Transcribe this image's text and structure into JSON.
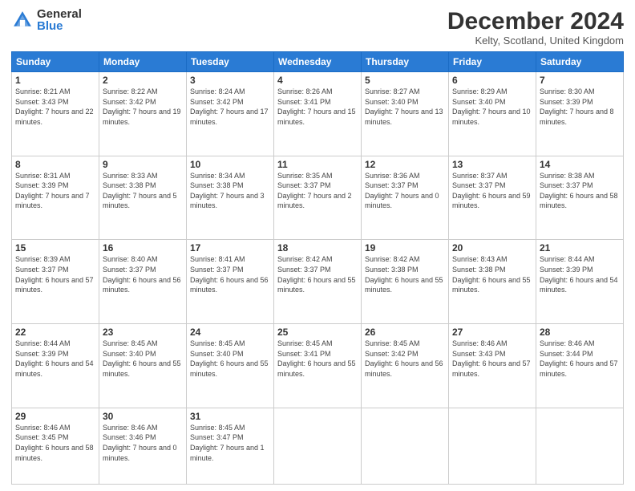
{
  "logo": {
    "general": "General",
    "blue": "Blue"
  },
  "title": "December 2024",
  "location": "Kelty, Scotland, United Kingdom",
  "days_of_week": [
    "Sunday",
    "Monday",
    "Tuesday",
    "Wednesday",
    "Thursday",
    "Friday",
    "Saturday"
  ],
  "weeks": [
    [
      {
        "day": "1",
        "sunrise": "Sunrise: 8:21 AM",
        "sunset": "Sunset: 3:43 PM",
        "daylight": "Daylight: 7 hours and 22 minutes."
      },
      {
        "day": "2",
        "sunrise": "Sunrise: 8:22 AM",
        "sunset": "Sunset: 3:42 PM",
        "daylight": "Daylight: 7 hours and 19 minutes."
      },
      {
        "day": "3",
        "sunrise": "Sunrise: 8:24 AM",
        "sunset": "Sunset: 3:42 PM",
        "daylight": "Daylight: 7 hours and 17 minutes."
      },
      {
        "day": "4",
        "sunrise": "Sunrise: 8:26 AM",
        "sunset": "Sunset: 3:41 PM",
        "daylight": "Daylight: 7 hours and 15 minutes."
      },
      {
        "day": "5",
        "sunrise": "Sunrise: 8:27 AM",
        "sunset": "Sunset: 3:40 PM",
        "daylight": "Daylight: 7 hours and 13 minutes."
      },
      {
        "day": "6",
        "sunrise": "Sunrise: 8:29 AM",
        "sunset": "Sunset: 3:40 PM",
        "daylight": "Daylight: 7 hours and 10 minutes."
      },
      {
        "day": "7",
        "sunrise": "Sunrise: 8:30 AM",
        "sunset": "Sunset: 3:39 PM",
        "daylight": "Daylight: 7 hours and 8 minutes."
      }
    ],
    [
      {
        "day": "8",
        "sunrise": "Sunrise: 8:31 AM",
        "sunset": "Sunset: 3:39 PM",
        "daylight": "Daylight: 7 hours and 7 minutes."
      },
      {
        "day": "9",
        "sunrise": "Sunrise: 8:33 AM",
        "sunset": "Sunset: 3:38 PM",
        "daylight": "Daylight: 7 hours and 5 minutes."
      },
      {
        "day": "10",
        "sunrise": "Sunrise: 8:34 AM",
        "sunset": "Sunset: 3:38 PM",
        "daylight": "Daylight: 7 hours and 3 minutes."
      },
      {
        "day": "11",
        "sunrise": "Sunrise: 8:35 AM",
        "sunset": "Sunset: 3:37 PM",
        "daylight": "Daylight: 7 hours and 2 minutes."
      },
      {
        "day": "12",
        "sunrise": "Sunrise: 8:36 AM",
        "sunset": "Sunset: 3:37 PM",
        "daylight": "Daylight: 7 hours and 0 minutes."
      },
      {
        "day": "13",
        "sunrise": "Sunrise: 8:37 AM",
        "sunset": "Sunset: 3:37 PM",
        "daylight": "Daylight: 6 hours and 59 minutes."
      },
      {
        "day": "14",
        "sunrise": "Sunrise: 8:38 AM",
        "sunset": "Sunset: 3:37 PM",
        "daylight": "Daylight: 6 hours and 58 minutes."
      }
    ],
    [
      {
        "day": "15",
        "sunrise": "Sunrise: 8:39 AM",
        "sunset": "Sunset: 3:37 PM",
        "daylight": "Daylight: 6 hours and 57 minutes."
      },
      {
        "day": "16",
        "sunrise": "Sunrise: 8:40 AM",
        "sunset": "Sunset: 3:37 PM",
        "daylight": "Daylight: 6 hours and 56 minutes."
      },
      {
        "day": "17",
        "sunrise": "Sunrise: 8:41 AM",
        "sunset": "Sunset: 3:37 PM",
        "daylight": "Daylight: 6 hours and 56 minutes."
      },
      {
        "day": "18",
        "sunrise": "Sunrise: 8:42 AM",
        "sunset": "Sunset: 3:37 PM",
        "daylight": "Daylight: 6 hours and 55 minutes."
      },
      {
        "day": "19",
        "sunrise": "Sunrise: 8:42 AM",
        "sunset": "Sunset: 3:38 PM",
        "daylight": "Daylight: 6 hours and 55 minutes."
      },
      {
        "day": "20",
        "sunrise": "Sunrise: 8:43 AM",
        "sunset": "Sunset: 3:38 PM",
        "daylight": "Daylight: 6 hours and 55 minutes."
      },
      {
        "day": "21",
        "sunrise": "Sunrise: 8:44 AM",
        "sunset": "Sunset: 3:39 PM",
        "daylight": "Daylight: 6 hours and 54 minutes."
      }
    ],
    [
      {
        "day": "22",
        "sunrise": "Sunrise: 8:44 AM",
        "sunset": "Sunset: 3:39 PM",
        "daylight": "Daylight: 6 hours and 54 minutes."
      },
      {
        "day": "23",
        "sunrise": "Sunrise: 8:45 AM",
        "sunset": "Sunset: 3:40 PM",
        "daylight": "Daylight: 6 hours and 55 minutes."
      },
      {
        "day": "24",
        "sunrise": "Sunrise: 8:45 AM",
        "sunset": "Sunset: 3:40 PM",
        "daylight": "Daylight: 6 hours and 55 minutes."
      },
      {
        "day": "25",
        "sunrise": "Sunrise: 8:45 AM",
        "sunset": "Sunset: 3:41 PM",
        "daylight": "Daylight: 6 hours and 55 minutes."
      },
      {
        "day": "26",
        "sunrise": "Sunrise: 8:45 AM",
        "sunset": "Sunset: 3:42 PM",
        "daylight": "Daylight: 6 hours and 56 minutes."
      },
      {
        "day": "27",
        "sunrise": "Sunrise: 8:46 AM",
        "sunset": "Sunset: 3:43 PM",
        "daylight": "Daylight: 6 hours and 57 minutes."
      },
      {
        "day": "28",
        "sunrise": "Sunrise: 8:46 AM",
        "sunset": "Sunset: 3:44 PM",
        "daylight": "Daylight: 6 hours and 57 minutes."
      }
    ],
    [
      {
        "day": "29",
        "sunrise": "Sunrise: 8:46 AM",
        "sunset": "Sunset: 3:45 PM",
        "daylight": "Daylight: 6 hours and 58 minutes."
      },
      {
        "day": "30",
        "sunrise": "Sunrise: 8:46 AM",
        "sunset": "Sunset: 3:46 PM",
        "daylight": "Daylight: 7 hours and 0 minutes."
      },
      {
        "day": "31",
        "sunrise": "Sunrise: 8:45 AM",
        "sunset": "Sunset: 3:47 PM",
        "daylight": "Daylight: 7 hours and 1 minute."
      },
      {
        "day": "",
        "sunrise": "",
        "sunset": "",
        "daylight": ""
      },
      {
        "day": "",
        "sunrise": "",
        "sunset": "",
        "daylight": ""
      },
      {
        "day": "",
        "sunrise": "",
        "sunset": "",
        "daylight": ""
      },
      {
        "day": "",
        "sunrise": "",
        "sunset": "",
        "daylight": ""
      }
    ]
  ]
}
